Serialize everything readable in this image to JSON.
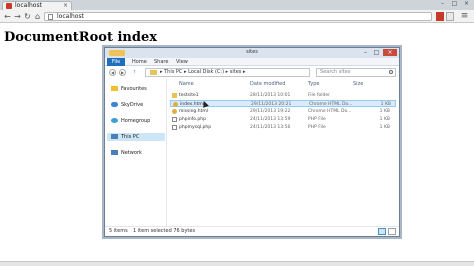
{
  "browser": {
    "tab_title": "localhost",
    "tab_close": "×",
    "window_controls": [
      "–",
      "□",
      "×"
    ],
    "url": "localhost",
    "nav_icons": [
      "back-arrow",
      "forward-arrow",
      "reload",
      "home"
    ]
  },
  "page": {
    "heading": "DocumentRoot index"
  },
  "explorer": {
    "title": "sites",
    "controls": [
      "–",
      "□",
      "×"
    ],
    "ribbon_tabs": [
      "File",
      "Home",
      "Share",
      "View"
    ],
    "address": {
      "path": "▸  This PC  ▸  Local Disk (C:)  ▸  sites  ▸"
    },
    "search": {
      "placeholder": "Search sites"
    },
    "nav_pane": [
      {
        "label": "Favourites",
        "icon": "star-icon",
        "color": "#f0c030"
      },
      {
        "label": "SkyDrive",
        "icon": "cloud-icon",
        "color": "#3a86d6"
      },
      {
        "label": "Homegroup",
        "icon": "homegroup-icon",
        "color": "#3aa0d6"
      },
      {
        "label": "This PC",
        "icon": "computer-icon",
        "color": "#4a7fb8",
        "selected": true
      },
      {
        "label": "Network",
        "icon": "network-icon",
        "color": "#4a7fb8"
      }
    ],
    "columns": {
      "name": "Name",
      "date": "Date modified",
      "type": "Type",
      "size": "Size"
    },
    "files": [
      {
        "name": "testsite1",
        "date": "28/11/2013 10:01",
        "type": "File folder",
        "size": "",
        "icon": "folder-icon",
        "color": "#e8c35a"
      },
      {
        "name": "index.html",
        "date": "29/11/2013 20:21",
        "type": "Chrome HTML Do...",
        "size": "1 KB",
        "icon": "chrome-html-icon",
        "color": "#dfb040",
        "hover": true
      },
      {
        "name": "missing.html",
        "date": "29/11/2013 19:22",
        "type": "Chrome HTML Do...",
        "size": "1 KB",
        "icon": "chrome-html-icon",
        "color": "#dfb040"
      },
      {
        "name": "phpinfo.php",
        "date": "24/11/2013 13:59",
        "type": "PHP File",
        "size": "1 KB",
        "icon": "php-file-icon",
        "color": "#ffffff"
      },
      {
        "name": "phpmysql.php",
        "date": "24/11/2013 13:56",
        "type": "PHP File",
        "size": "1 KB",
        "icon": "php-file-icon",
        "color": "#ffffff"
      }
    ],
    "status": {
      "items": "5 items",
      "selected": "1 item selected  76 bytes"
    }
  }
}
